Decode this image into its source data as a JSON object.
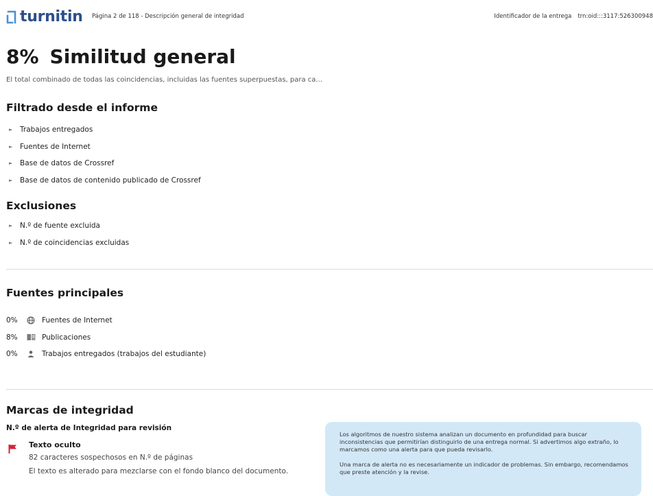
{
  "header": {
    "logo_text": "turnitin",
    "page_info": "Página 2 de 118 - Descripción general de integridad",
    "submission_label": "Identificador de la entrega",
    "submission_id": "trn:oid:::3117:526300948"
  },
  "overview": {
    "percent": "8%",
    "title": "Similitud general",
    "subtitle": "El total combinado de todas las coincidencias, incluidas las fuentes superpuestas, para ca..."
  },
  "filters": {
    "heading": "Filtrado desde el informe",
    "items": [
      "Trabajos entregados",
      "Fuentes de Internet",
      "Base de datos de Crossref",
      "Base de datos de contenido publicado de Crossref"
    ]
  },
  "exclusions": {
    "heading": "Exclusiones",
    "items": [
      "N.º de fuente excluida",
      "N.º de coincidencias excluidas"
    ]
  },
  "top_sources": {
    "heading": "Fuentes principales",
    "rows": [
      {
        "percent": "0%",
        "label": "Fuentes de Internet",
        "icon": "globe-icon"
      },
      {
        "percent": "8%",
        "label": "Publicaciones",
        "icon": "book-icon"
      },
      {
        "percent": "0%",
        "label": "Trabajos entregados (trabajos del estudiante)",
        "icon": "person-icon"
      }
    ]
  },
  "integrity": {
    "heading": "Marcas de integridad",
    "alert_heading": "N.º de alerta de Integridad para revisión",
    "flag_title": "Texto oculto",
    "flag_line1": "82 caracteres sospechosos en N.º de páginas",
    "flag_line2": "El texto es alterado para mezclarse con el fondo blanco del documento.",
    "info_p1": "Los algoritmos de nuestro sistema analizan un documento en profundidad para buscar inconsistencias que permitirían distinguirlo de una entrega normal. Si advertimos algo extraño, lo marcamos como una alerta para que pueda revisarlo.",
    "info_p2": "Una marca de alerta no es necesariamente un indicador de problemas. Sin embargo, recomendamos que preste atención y la revise."
  },
  "colors": {
    "brand": "#2b4f8a",
    "flag": "#d0253a",
    "info_bg": "#d3e8f7"
  }
}
